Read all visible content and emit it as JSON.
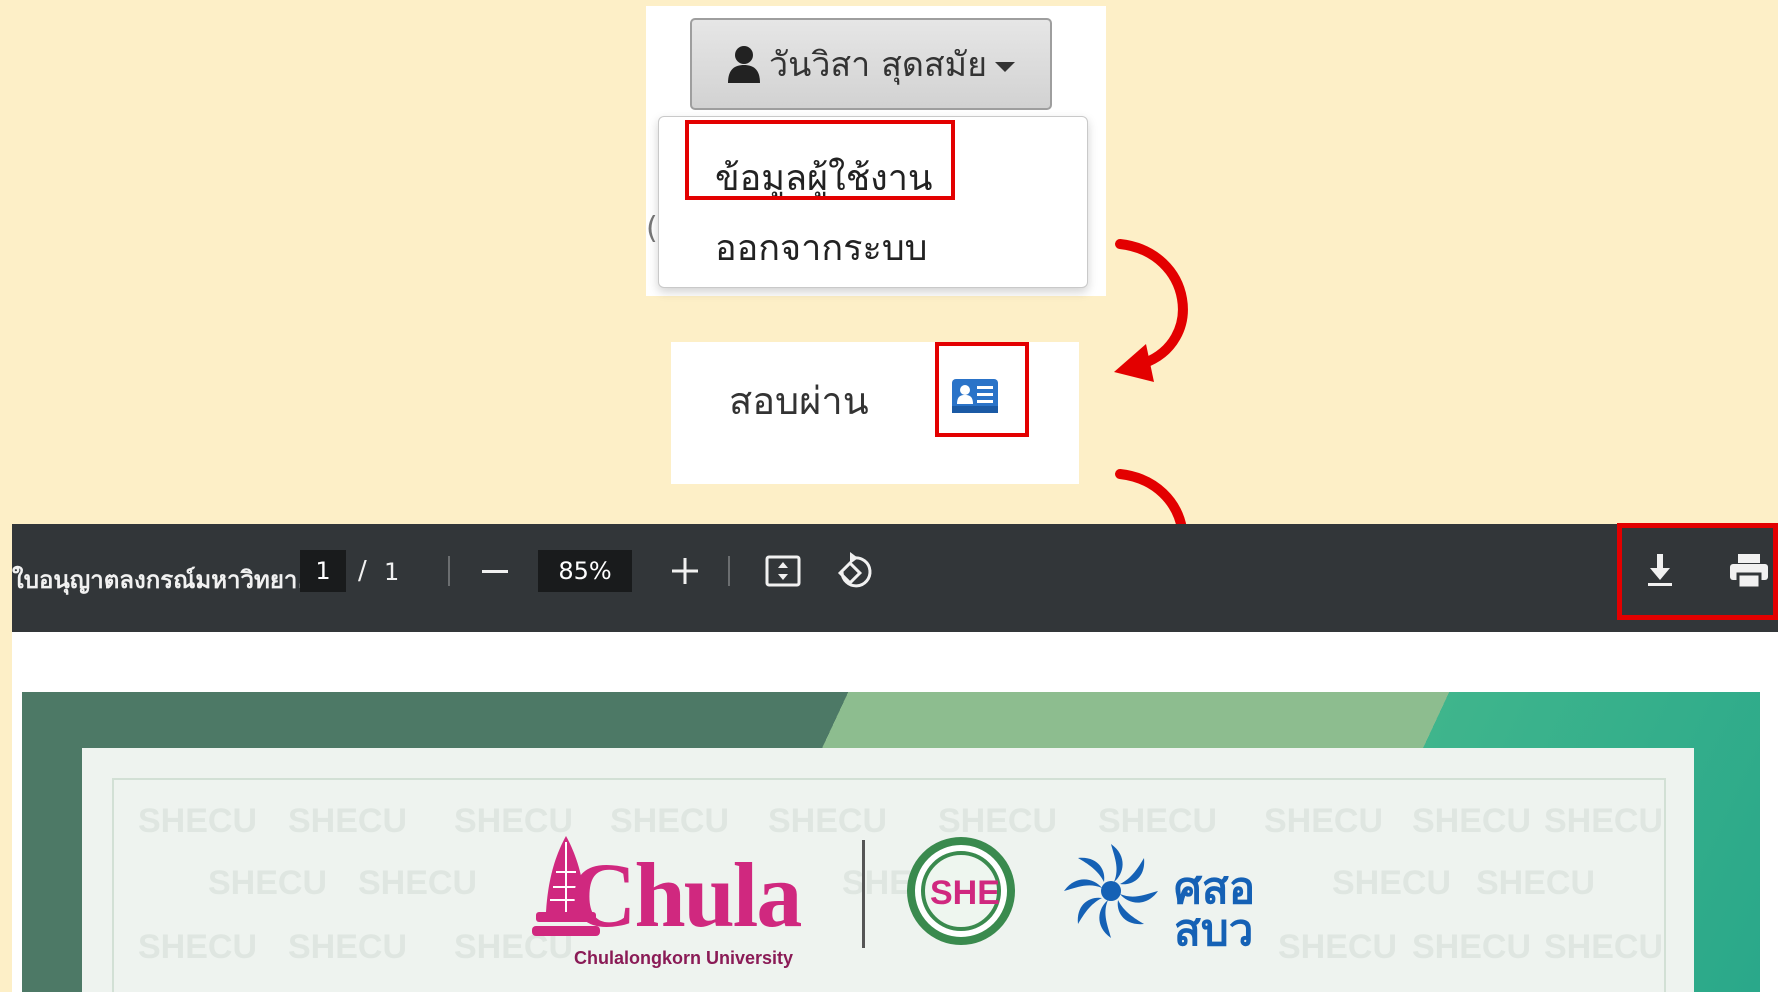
{
  "user_menu": {
    "user_name": "วันวิสา สุดสมัย",
    "items": [
      "ข้อมูลผู้ใช้งาน",
      "ออกจากระบบ"
    ],
    "peek_char": "("
  },
  "status": {
    "label": "สอบผ่าน"
  },
  "pdf_viewer": {
    "title": "ใบอนุญาตลงกรณ์มหาวิทยา...",
    "page_current": "1",
    "page_sep": "/",
    "page_total": "1",
    "zoom": "85%"
  },
  "certificate": {
    "watermark": "SHECU",
    "logo_text": "Chula",
    "logo_subtext": "Chulalongkorn University",
    "thai_logo_line1": "ศสอ",
    "thai_logo_line2": "สบว"
  },
  "colors": {
    "highlight": "#e30000",
    "background": "#fdefc7",
    "toolbar": "#323639",
    "chula_pink": "#d0287f",
    "card_icon_blue": "#2a73c8"
  },
  "icons": [
    "person-icon",
    "caret-down-icon",
    "id-card-icon",
    "fit-page-icon",
    "rotate-icon",
    "download-icon",
    "print-icon"
  ]
}
